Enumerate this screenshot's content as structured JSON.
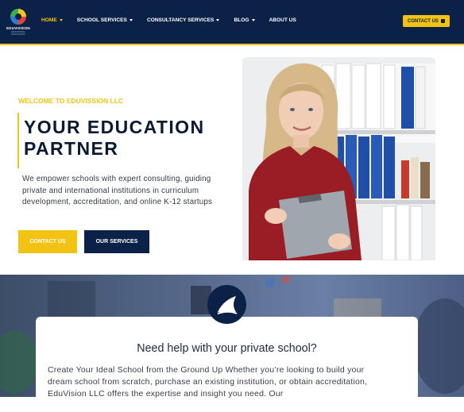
{
  "brand": {
    "name": "EDUVISSION",
    "tagline": "EDUCATIONAL CONSULTANCY",
    "colors": {
      "navy": "#0b2148",
      "gold": "#f2c312"
    }
  },
  "nav": {
    "items": [
      {
        "label": "HOME",
        "has_dropdown": true,
        "active": true
      },
      {
        "label": "SCHOOL SERVICES",
        "has_dropdown": true
      },
      {
        "label": "CONSULTANCY SERVICES",
        "has_dropdown": true
      },
      {
        "label": "BLOG",
        "has_dropdown": true
      },
      {
        "label": "ABOUT US",
        "has_dropdown": false
      }
    ],
    "contact_label": "CONTACT US",
    "contact_icon": "calendar-icon"
  },
  "hero": {
    "welcome": "WELCOME TO EDUVISSION LLC",
    "title": "YOUR EDUCATION PARTNER",
    "description": "We empower schools with expert consulting, guiding private and international institutions in curriculum development, accreditation, and online K-12 startups",
    "contact_button": "CONTACT US",
    "services_button": "OUR SERVICES",
    "image_icon": "teacher-photo"
  },
  "section": {
    "badge_icon": "shark-fin-icon",
    "title": "Need help with your private school?",
    "text": "Create Your Ideal School from the Ground Up Whether you’re looking to build your dream school from scratch, purchase an existing institution, or obtain accreditation, EduVision LLC offers the expertise and insight you need. Our"
  }
}
